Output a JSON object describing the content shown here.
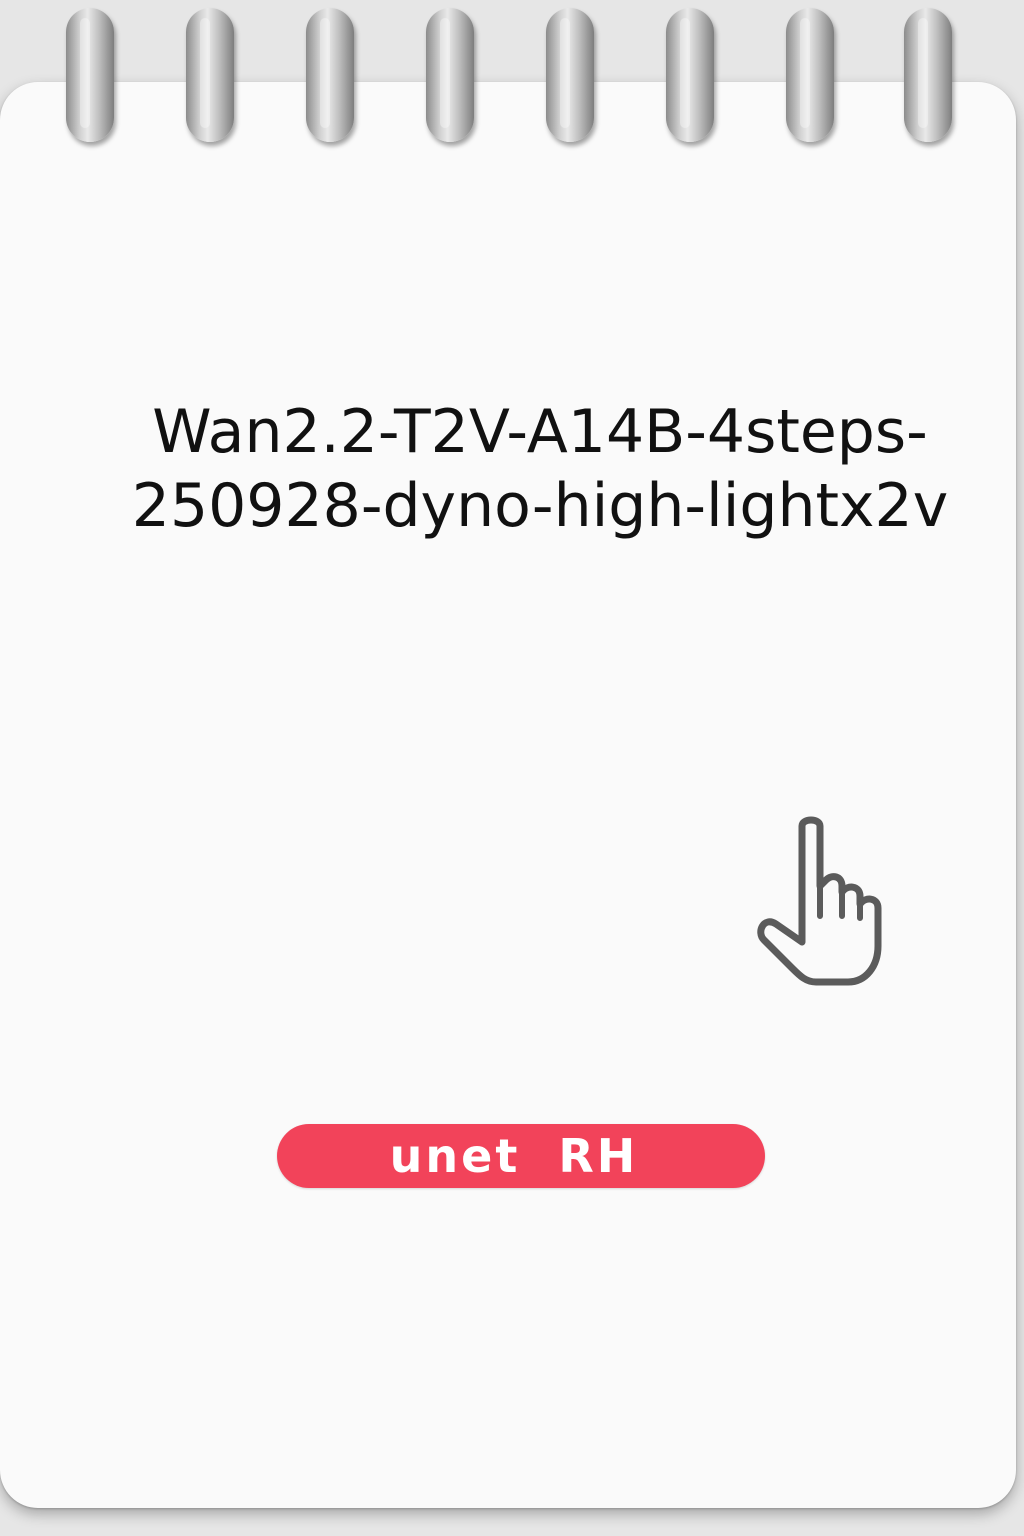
{
  "title": {
    "line1": "Wan2.2-T2V-A14B-4steps-",
    "line2": "250928-dyno-high-lightx2v"
  },
  "icon": "pointing-hand-icon",
  "badge": {
    "label": "unet  RH",
    "color": "#f2435a"
  }
}
